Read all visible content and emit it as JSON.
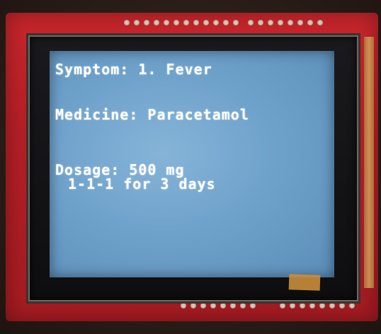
{
  "screen": {
    "symptom_line": "Symptom: 1. Fever",
    "medicine_line": "Medicine: Paracetamol",
    "dosage_line": "Dosage: 500 mg",
    "dosage_schedule_line": "1-1-1 for 3 days"
  },
  "colors": {
    "pcb": "#b51f26",
    "screen_backlight": "#6fa2cb",
    "text": "#ffffff"
  }
}
